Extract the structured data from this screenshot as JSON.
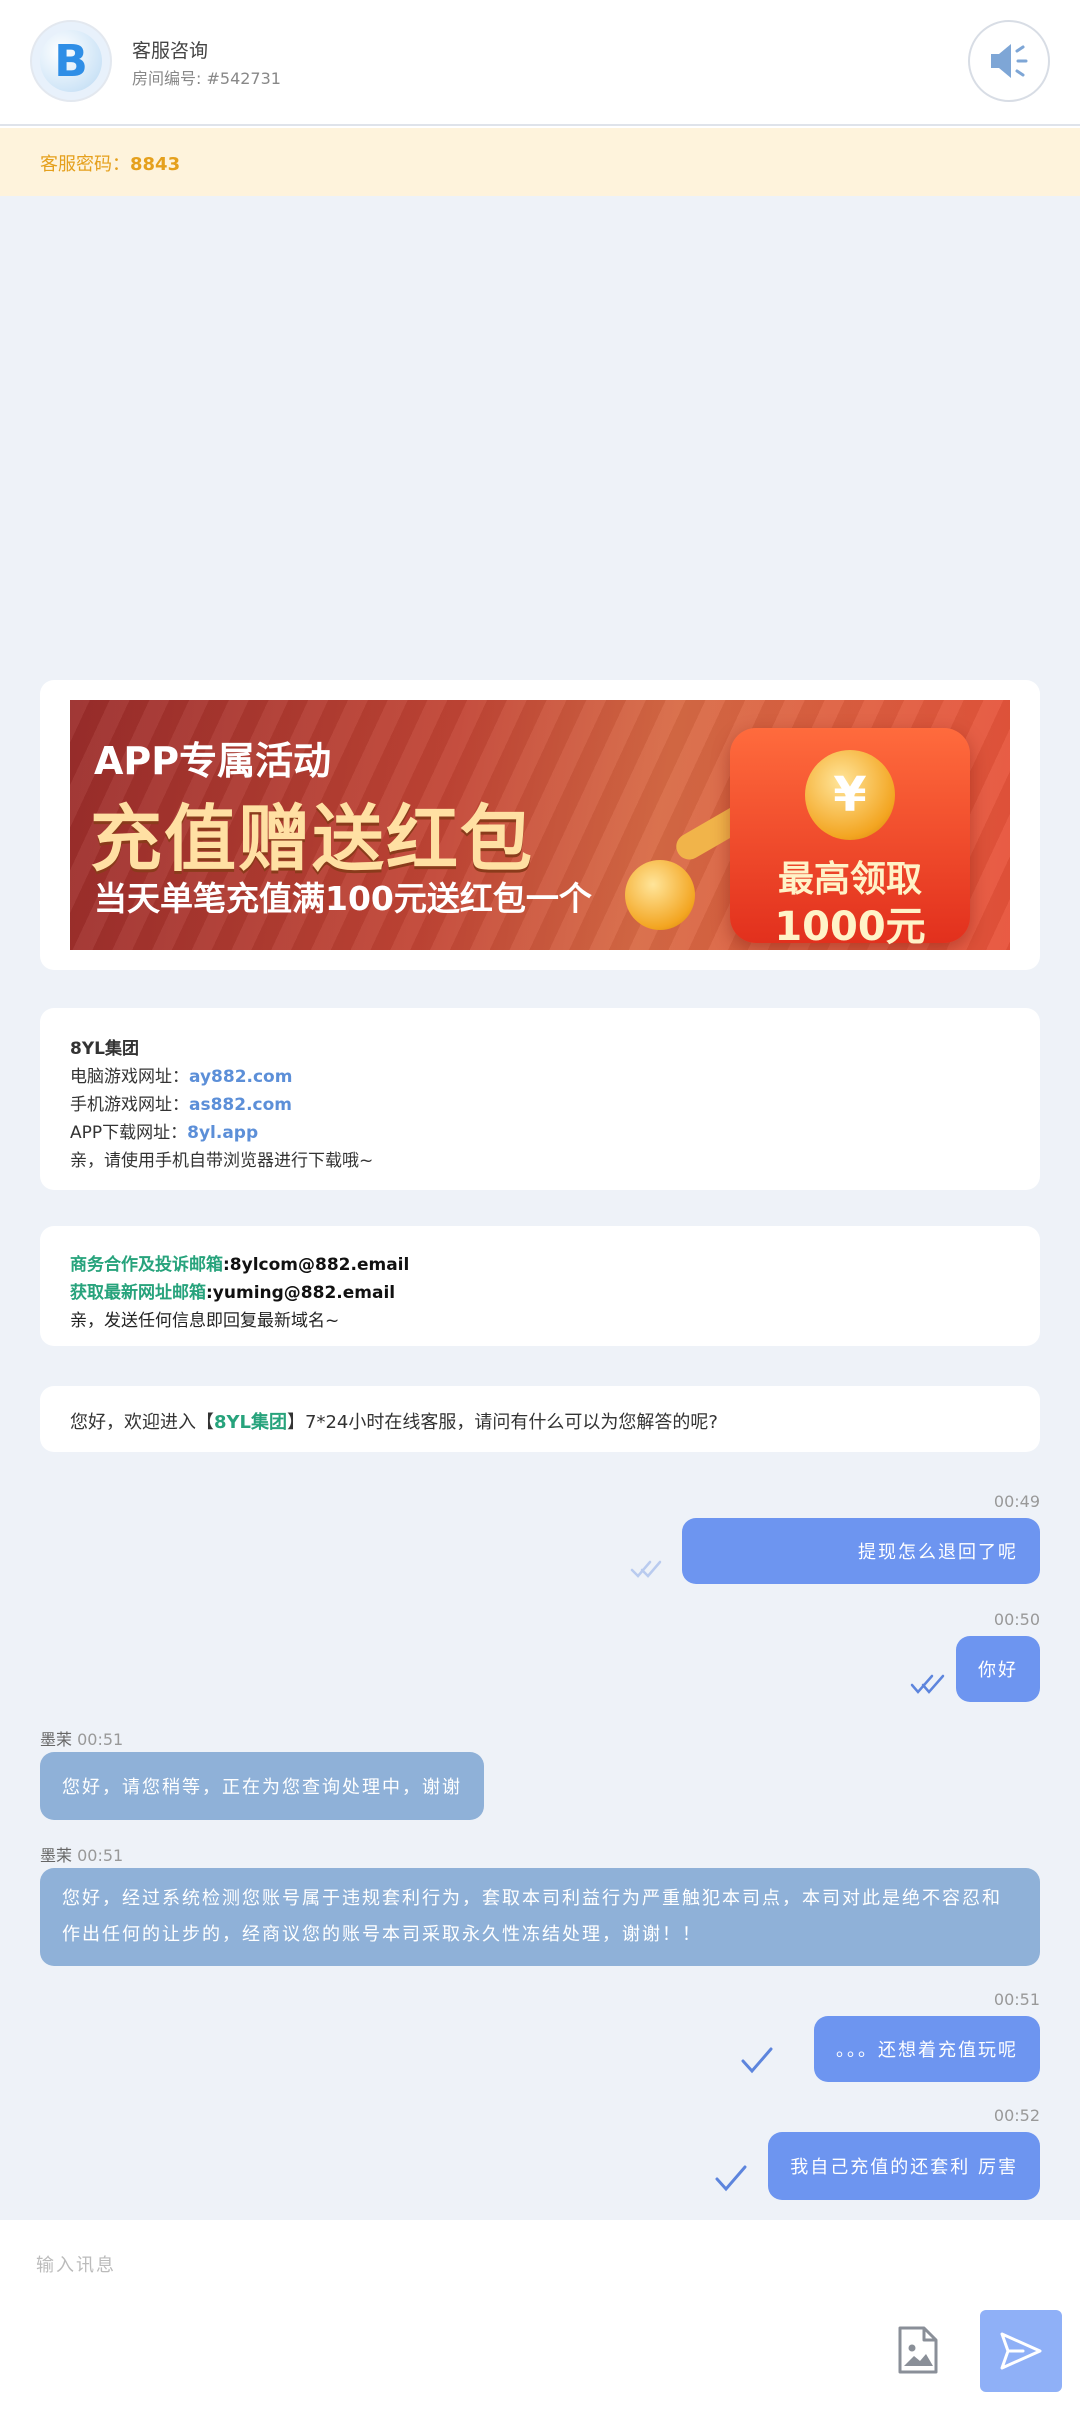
{
  "header": {
    "title": "客服咨询",
    "room": "房间编号: #542731",
    "avatar_letter": "B"
  },
  "password_bar": {
    "label": "客服密码：",
    "value": "8843"
  },
  "banner": {
    "line1": "APP专属活动",
    "line2": "充值赠送红包",
    "line3": "当天单笔充值满100元送红包一个",
    "redpack_line1": "最高领取",
    "redpack_line2": "1000元",
    "coin_symbol": "¥"
  },
  "info": {
    "group": "8YL集团",
    "pc_label": "电脑游戏网址：",
    "pc_url": "ay882.com",
    "mobile_label": "手机游戏网址：",
    "mobile_url": "as882.com",
    "app_label": "APP下载网址：",
    "app_url": "8yl.app",
    "note": "亲，请使用手机自带浏览器进行下载哦~"
  },
  "mail": {
    "biz_label": "商务合作及投诉邮箱",
    "biz_email": ":8ylcom@882.email",
    "latest_label": "获取最新网址邮箱",
    "latest_email": ":yuming@882.email",
    "note": "亲，发送任何信息即回复最新域名~"
  },
  "welcome": {
    "pre": "您好，欢迎进入【",
    "brand": "8YL集团",
    "post": "】7*24小时在线客服，请问有什么可以为您解答的呢?"
  },
  "messages": [
    {
      "side": "right",
      "time": "00:49",
      "text": "提现怎么退回了呢"
    },
    {
      "side": "right",
      "time": "00:50",
      "text": "你好"
    },
    {
      "side": "left",
      "name": "墨茉",
      "time": "00:51",
      "text": "您好，请您稍等，正在为您查询处理中，谢谢"
    },
    {
      "side": "left",
      "name": "墨茉",
      "time": "00:51",
      "text": "您好，经过系统检测您账号属于违规套利行为，套取本司利益行为严重触犯本司点，本司对此是绝不容忍和作出任何的让步的，经商议您的账号本司采取永久性冻结处理，谢谢！！"
    },
    {
      "side": "right",
      "time": "00:51",
      "text": "。。。还想着充值玩呢"
    },
    {
      "side": "right",
      "time": "00:52",
      "text": "我自己充值的还套利 厉害"
    }
  ],
  "input": {
    "placeholder": "输入讯息"
  },
  "colors": {
    "accent": "#6d95f0",
    "agent_bubble": "#8fb1d8",
    "green": "#27a37c",
    "link": "#5c8fd8",
    "warning": "#e5a01d"
  }
}
